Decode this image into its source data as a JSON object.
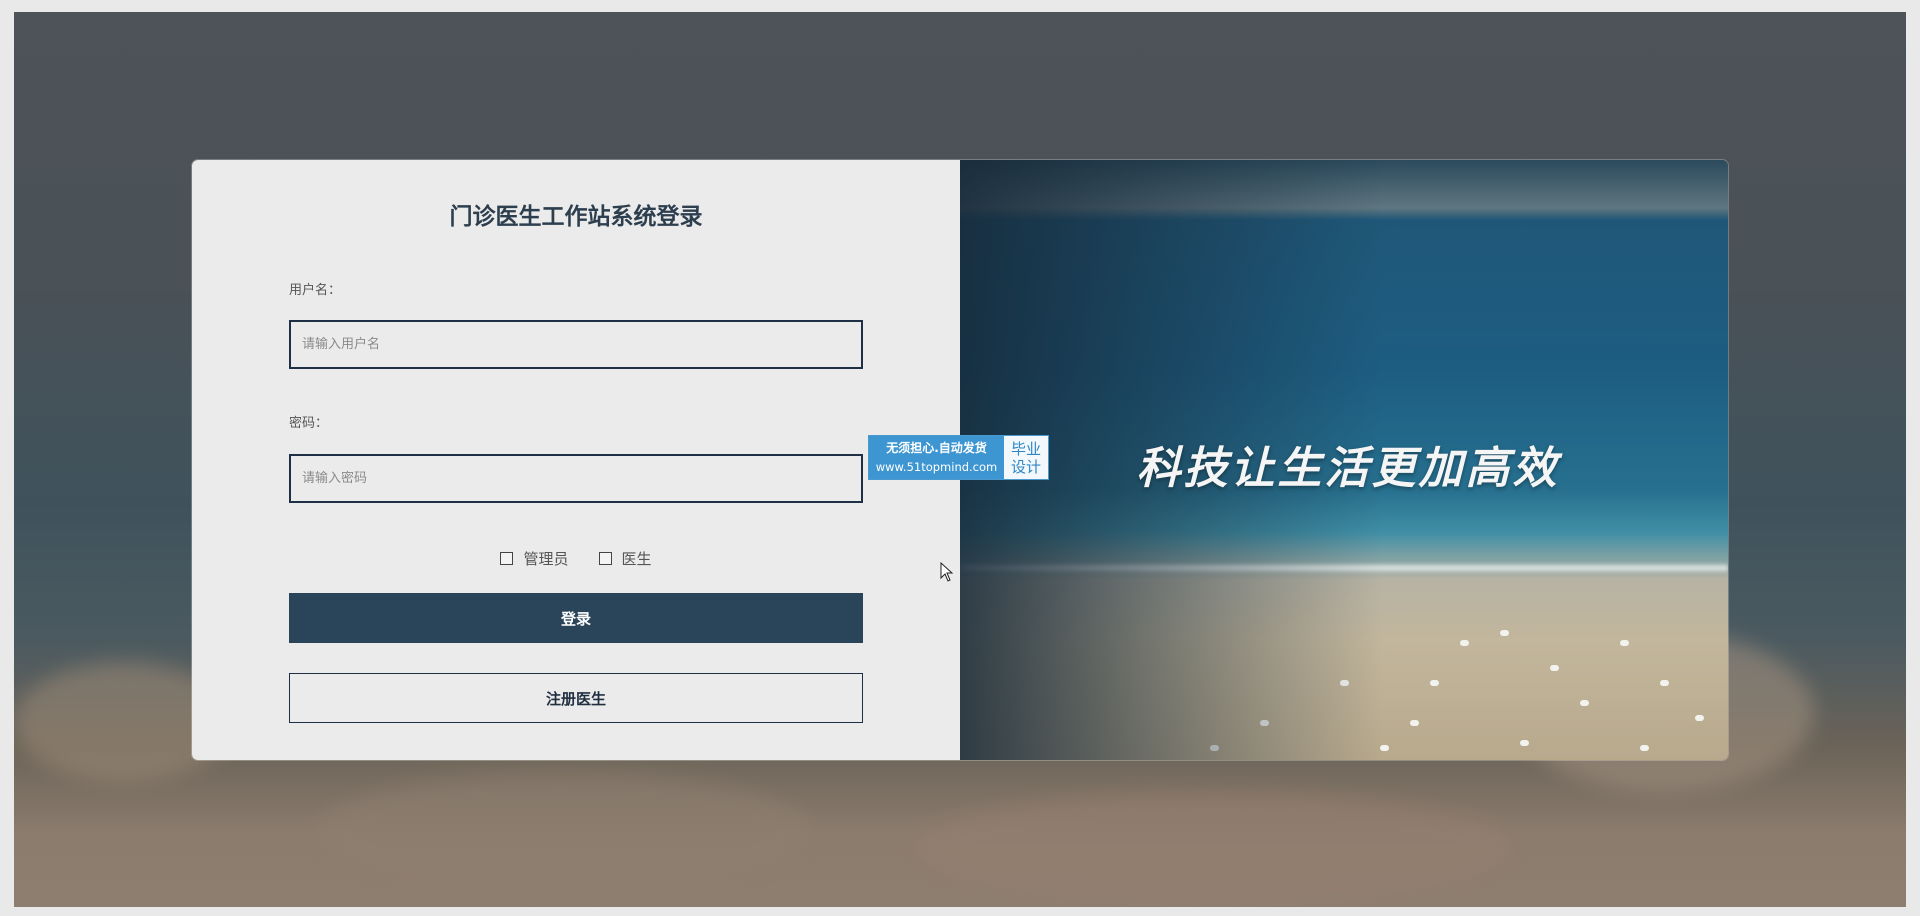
{
  "login": {
    "title": "门诊医生工作站系统登录",
    "username_label": "用户名：",
    "username_placeholder": "请输入用户名",
    "username_value": "",
    "password_label": "密码：",
    "password_placeholder": "请输入密码",
    "password_value": "",
    "roles": [
      {
        "label": "管理员",
        "checked": false
      },
      {
        "label": "医生",
        "checked": false
      }
    ],
    "login_button": "登录",
    "register_button": "注册医生"
  },
  "banner": {
    "slogan": "科技让生活更加高效"
  },
  "watermark": {
    "line1": "无须担心.自动发货",
    "line2": "www.51topmind.com",
    "badge_line1": "毕业",
    "badge_line2": "设计"
  }
}
